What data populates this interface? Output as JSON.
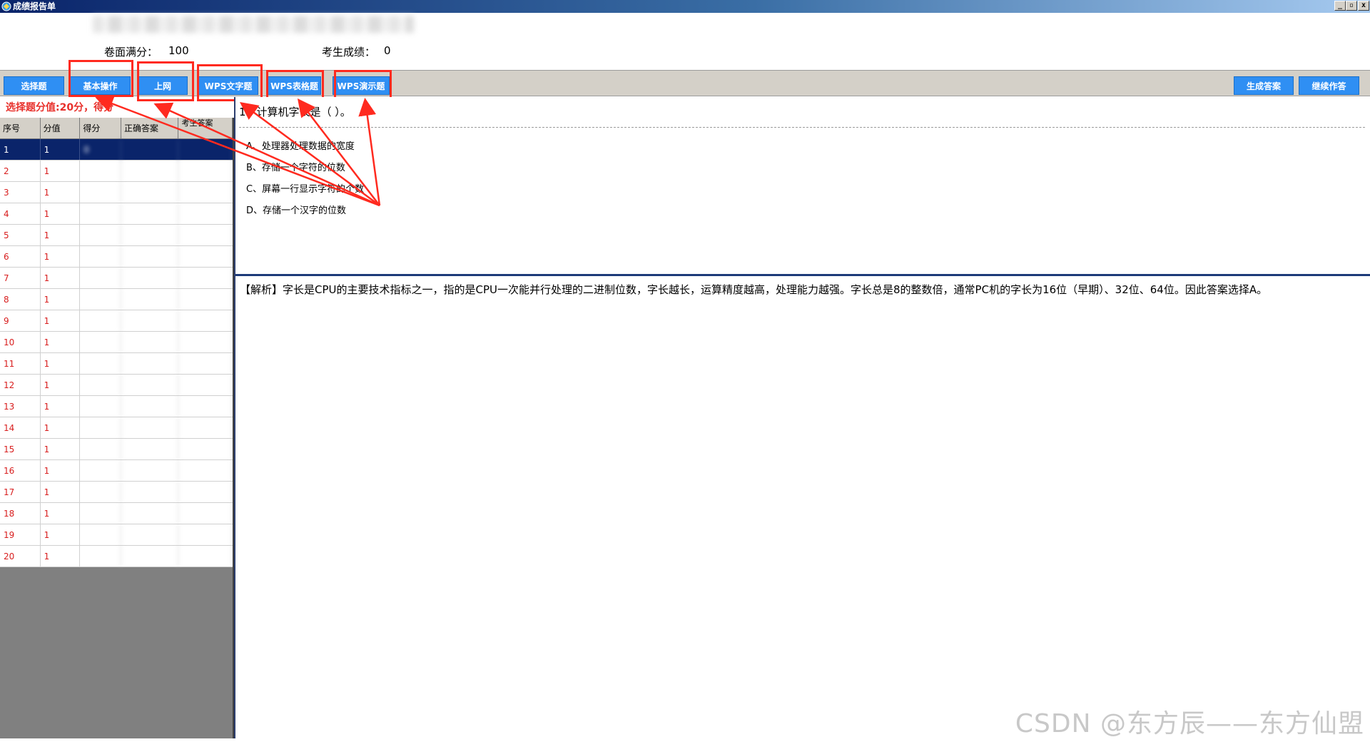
{
  "window": {
    "title": "成绩报告单",
    "min_glyph": "_",
    "max_glyph": "▫",
    "close_glyph": "x"
  },
  "score_info": {
    "full_label": "卷面满分：",
    "full_value": "100",
    "score_label": "考生成绩：",
    "score_value": "0"
  },
  "toolbar": {
    "tabs": [
      "选择题",
      "基本操作",
      "上网",
      "WPS文字题",
      "WPS表格题",
      "WPS演示题"
    ],
    "generate_answer": "生成答案",
    "continue_work": "继续作答"
  },
  "section_note": "选择题分值:20分，得分",
  "grid": {
    "headers": [
      "序号",
      "分值",
      "得分",
      "正确答案",
      "考生答案"
    ],
    "rows": [
      {
        "no": "1",
        "value": "1",
        "score": "0"
      },
      {
        "no": "2",
        "value": "1"
      },
      {
        "no": "3",
        "value": "1"
      },
      {
        "no": "4",
        "value": "1"
      },
      {
        "no": "5",
        "value": "1"
      },
      {
        "no": "6",
        "value": "1"
      },
      {
        "no": "7",
        "value": "1"
      },
      {
        "no": "8",
        "value": "1"
      },
      {
        "no": "9",
        "value": "1"
      },
      {
        "no": "10",
        "value": "1"
      },
      {
        "no": "11",
        "value": "1"
      },
      {
        "no": "12",
        "value": "1"
      },
      {
        "no": "13",
        "value": "1"
      },
      {
        "no": "14",
        "value": "1"
      },
      {
        "no": "15",
        "value": "1"
      },
      {
        "no": "16",
        "value": "1"
      },
      {
        "no": "17",
        "value": "1"
      },
      {
        "no": "18",
        "value": "1"
      },
      {
        "no": "19",
        "value": "1"
      },
      {
        "no": "20",
        "value": "1"
      }
    ]
  },
  "question": {
    "title": "1、计算机字长是（ ）。",
    "options": [
      "A、处理器处理数据的宽度",
      "B、存储一个字符的位数",
      "C、屏幕一行显示字符的个数",
      "D、存储一个汉字的位数"
    ]
  },
  "analysis": "【解析】字长是CPU的主要技术指标之一，指的是CPU一次能并行处理的二进制位数，字长越长，运算精度越高，处理能力越强。字长总是8的整数倍，通常PC机的字长为16位（早期）、32位、64位。因此答案选择A。",
  "watermark": "CSDN @东方辰——东方仙盟",
  "colors": {
    "tab_button": "#2f8ff3",
    "highlight": "#ff2a1f",
    "selected_row": "#0a246a",
    "row_text": "#d81e1e"
  }
}
